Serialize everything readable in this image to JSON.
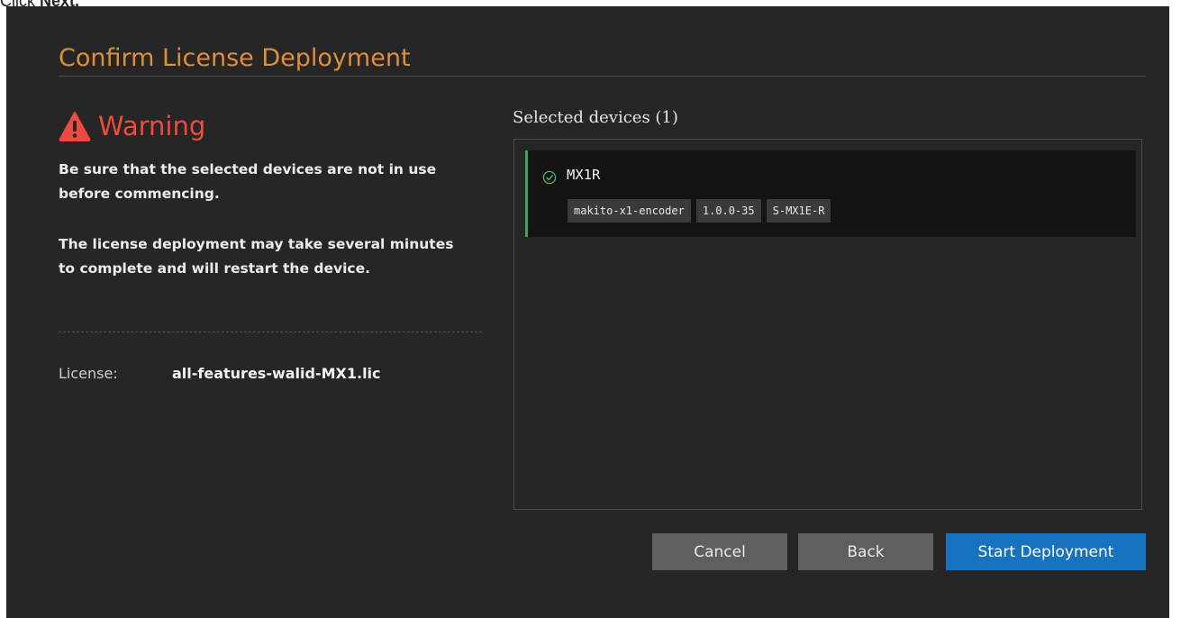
{
  "caption": {
    "prefix": "Click ",
    "emphasis": "Next."
  },
  "dialog": {
    "title": "Confirm License Deployment",
    "warning": {
      "icon": "warning-triangle-icon",
      "heading": "Warning",
      "message1": "Be sure that the selected devices are not in use before commencing.",
      "message2": "The license deployment may take several minutes to complete and will restart the device."
    },
    "license": {
      "label": "License:",
      "value": "all-features-walid-MX1.lic"
    },
    "selected": {
      "title": "Selected devices (1)",
      "devices": [
        {
          "icon": "check-circle-icon",
          "name": "MX1R",
          "tags": [
            "makito-x1-encoder",
            "1.0.0-35",
            "S-MX1E-R"
          ]
        }
      ]
    },
    "buttons": {
      "cancel": "Cancel",
      "back": "Back",
      "start": "Start Deployment"
    }
  },
  "colors": {
    "title": "#e08e39",
    "warning": "#f04a3f",
    "primary_button": "#1773bf",
    "device_accent": "#3da35d"
  }
}
